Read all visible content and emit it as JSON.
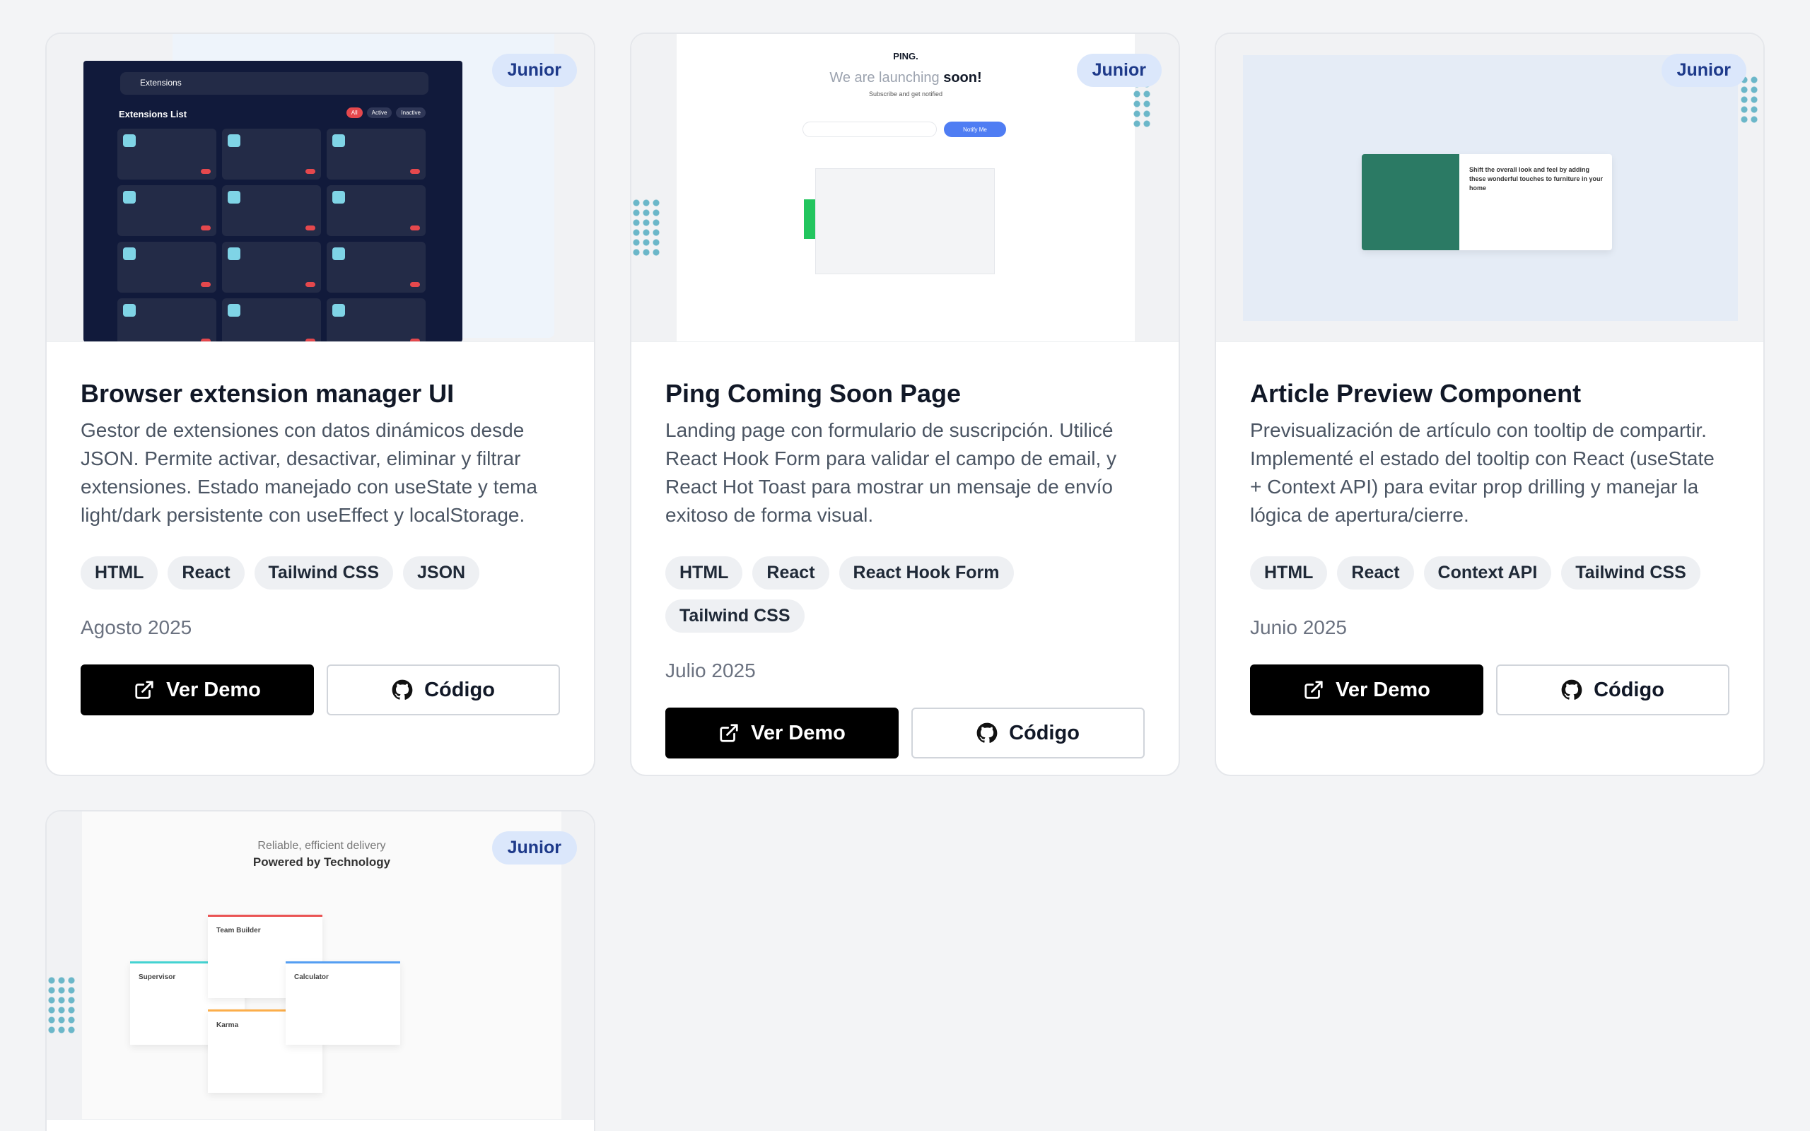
{
  "badge_label": "Junior",
  "ver_demo_label": "Ver Demo",
  "codigo_label": "Código",
  "projects": [
    {
      "title": "Browser extension manager UI",
      "description": "Gestor de extensiones con datos dinámicos desde JSON. Permite activar, desactivar, eliminar y filtrar extensiones. Estado manejado con useState y tema light/dark persistente con useEffect y localStorage.",
      "tags": [
        "HTML",
        "React",
        "Tailwind CSS",
        "JSON"
      ],
      "date": "Agosto 2025"
    },
    {
      "title": "Ping Coming Soon Page",
      "description": "Landing page con formulario de suscripción. Utilicé React Hook Form para validar el campo de email, y React Hot Toast para mostrar un mensaje de envío exitoso de forma visual.",
      "tags": [
        "HTML",
        "React",
        "React Hook Form",
        "Tailwind CSS"
      ],
      "date": "Julio 2025"
    },
    {
      "title": "Article Preview Component",
      "description": "Previsualización de artículo con tooltip de compartir. Implementé el estado del tooltip con React (useState + Context API) para evitar prop drilling y manejar la lógica de apertura/cierre.",
      "tags": [
        "HTML",
        "React",
        "Context API",
        "Tailwind CSS"
      ],
      "date": "Junio 2025"
    },
    {
      "title": "",
      "description": "",
      "tags": [],
      "date": ""
    }
  ],
  "thumbs": {
    "ext": {
      "header": "Extensions",
      "list_title": "Extensions List",
      "filters": [
        "All",
        "Active",
        "Inactive"
      ]
    },
    "ping": {
      "logo": "PING.",
      "headline_light": "We are launching",
      "headline_bold": "soon!",
      "sub": "Subscribe and get notified",
      "button": "Notify Me"
    },
    "article": {
      "text": "Shift the overall look and feel by adding these wonderful touches to furniture in your home"
    },
    "sunnyside": {
      "line1": "Reliable, efficient delivery",
      "line2": "Powered by Technology",
      "cards": [
        "Supervisor",
        "Team Builder",
        "Karma",
        "Calculator"
      ]
    }
  }
}
